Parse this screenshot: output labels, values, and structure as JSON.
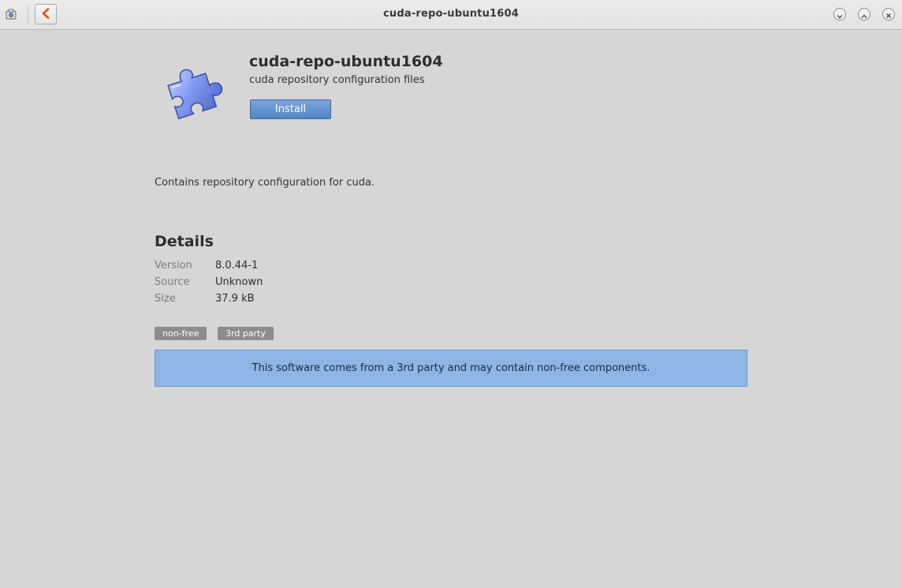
{
  "window": {
    "title": "cuda-repo-ubuntu1604"
  },
  "icons": {
    "app_menu": "app-menu-icon",
    "back": "chevron-left-icon",
    "minimize": "chevron-down-icon",
    "maximize": "chevron-up-icon",
    "close": "close-icon",
    "package": "puzzle-piece-icon"
  },
  "package": {
    "name": "cuda-repo-ubuntu1604",
    "summary": "cuda repository configuration files",
    "install_label": "Install",
    "description": "Contains repository configuration for cuda."
  },
  "details": {
    "heading": "Details",
    "rows": [
      {
        "label": "Version",
        "value": "8.0.44-1"
      },
      {
        "label": "Source",
        "value": "Unknown"
      },
      {
        "label": "Size",
        "value": "37.9 kB"
      }
    ]
  },
  "tags": [
    "non-free",
    "3rd party"
  ],
  "banner": {
    "text": "This software comes from a 3rd party and may contain non-free components."
  },
  "colors": {
    "background": "#d6d6d6",
    "accent": "#5585c6",
    "banner": "#8db5e6",
    "tag": "#8c8c8c",
    "back_arrow": "#e0521f"
  }
}
